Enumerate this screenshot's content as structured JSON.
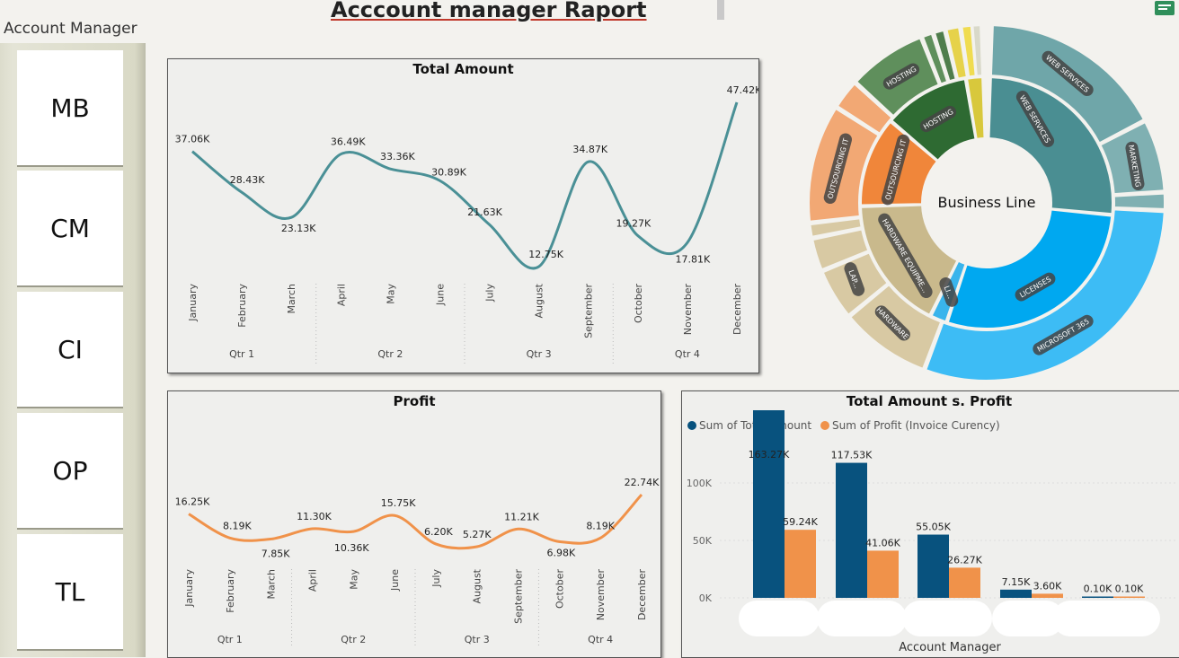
{
  "report": {
    "title": "Acccount  manager Raport "
  },
  "slicer": {
    "label": "Account Manager",
    "items": [
      "MB",
      "CM",
      "CI",
      "OP",
      "TL"
    ]
  },
  "colors": {
    "line_total": "#4a9096",
    "line_profit": "#f0924a",
    "bar_total": "#08527e",
    "bar_profit": "#f0924a"
  },
  "chart_data": [
    {
      "type": "line",
      "title": "Total Amount",
      "x": [
        "January",
        "February",
        "March",
        "April",
        "May",
        "June",
        "July",
        "August",
        "September",
        "October",
        "November",
        "December"
      ],
      "quarters": [
        "Qtr 1",
        "Qtr 2",
        "Qtr 3",
        "Qtr 4"
      ],
      "values": [
        37.06,
        28.43,
        23.13,
        36.49,
        33.36,
        30.89,
        21.63,
        12.75,
        34.87,
        19.27,
        17.81,
        47.42
      ],
      "labels": [
        "37.06K",
        "28.43K",
        "23.13K",
        "36.49K",
        "33.36K",
        "30.89K",
        "21.63K",
        "12.75K",
        "34.87K",
        "19.27K",
        "17.81K",
        "47.42K"
      ],
      "unit": "K"
    },
    {
      "type": "line",
      "title": "Profit",
      "x": [
        "January",
        "February",
        "March",
        "April",
        "May",
        "June",
        "July",
        "August",
        "September",
        "October",
        "November",
        "December"
      ],
      "quarters": [
        "Qtr 1",
        "Qtr 2",
        "Qtr 3",
        "Qtr 4"
      ],
      "values": [
        16.25,
        8.19,
        7.85,
        11.3,
        10.36,
        15.75,
        6.2,
        5.27,
        11.21,
        6.98,
        8.19,
        22.74
      ],
      "labels": [
        "16.25K",
        "8.19K",
        "7.85K",
        "11.30K",
        "10.36K",
        "15.75K",
        "6.20K",
        "5.27K",
        "11.21K",
        "6.98K",
        "8.19K",
        "22.74K"
      ],
      "unit": "K"
    },
    {
      "type": "bar",
      "title": "Total Amount s. Profit",
      "xlabel": "Account Manager",
      "legend_position": "top-left",
      "categories": [
        "",
        "",
        "",
        "",
        ""
      ],
      "yticks": [
        "0K",
        "50K",
        "100K"
      ],
      "ylim": [
        0,
        130
      ],
      "series": [
        {
          "name": "Sum of Total Amount",
          "values": [
            163.27,
            117.53,
            55.05,
            7.15,
            0.1
          ],
          "labels": [
            "163.27K",
            "117.53K",
            "55.05K",
            "7.15K",
            "0.10K"
          ]
        },
        {
          "name": "Sum of Profit (Invoice Curency)",
          "values": [
            59.24,
            41.06,
            26.27,
            3.6,
            0.1
          ],
          "labels": [
            "59.24K",
            "41.06K",
            "26.27K",
            "3.60K",
            "0.10K"
          ]
        }
      ]
    },
    {
      "type": "sunburst",
      "title": "Business Line",
      "inner": [
        {
          "label": "LICENSES",
          "color": "#00a8f0"
        },
        {
          "label": "LI...",
          "color": "#39b4ec"
        },
        {
          "label": "HARDWARE EQUIPME...",
          "color": "#c9b98c"
        },
        {
          "label": "OUTSOURCING IT",
          "color": "#f0863a"
        },
        {
          "label": "HOSTING",
          "color": "#2e6a32"
        },
        {
          "label": "",
          "color": "#d8c83c"
        },
        {
          "label": "WEB SERVICES",
          "color": "#4a8e92"
        }
      ],
      "outer": [
        {
          "label": "WEB SERVICES",
          "color": "#6fa6a9"
        },
        {
          "label": "MARKETING",
          "color": "#7fb0b2"
        },
        {
          "label": "MICROSOFT 365",
          "color": "#3dbcf5"
        },
        {
          "label": "HARDWARE",
          "color": "#d8c9a3"
        },
        {
          "label": "LAP...",
          "color": "#d8c9a3"
        },
        {
          "label": "OUTSOURCING IT",
          "color": "#f2a874"
        },
        {
          "label": "HOSTING",
          "color": "#5f8f5c"
        }
      ]
    }
  ]
}
